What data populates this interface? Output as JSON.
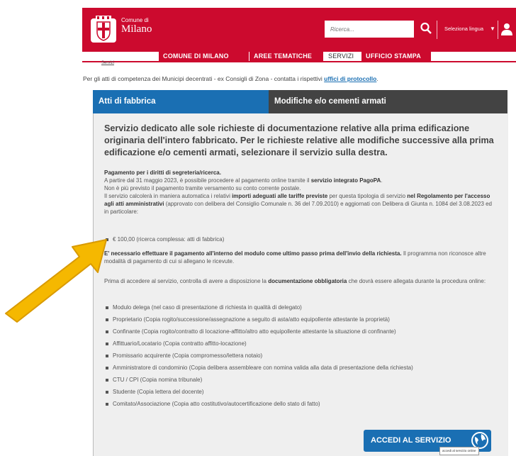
{
  "header": {
    "logo_small": "Comune di",
    "logo_big": "Milano",
    "search_placeholder": "Ricerca...",
    "language_label": "Seleziona lingua",
    "brand_color": "#cc0a2e"
  },
  "nav": {
    "items": [
      {
        "label": "COMUNE DI MILANO"
      },
      {
        "label": "AREE TEMATICHE"
      },
      {
        "label": "SERVIZI"
      },
      {
        "label": "UFFICIO STAMPA"
      }
    ],
    "active": "SERVIZI",
    "under_text": "Servizi"
  },
  "intro": {
    "text": "Per gli atti di competenza dei Municipi decentrati - ex Consigli di Zona - contatta i rispettivi ",
    "link": "uffici di protocollo",
    "end": "."
  },
  "tabs": [
    {
      "label": "Atti di fabbrica",
      "active": true
    },
    {
      "label": "Modifiche e/o cementi armati",
      "active": false
    }
  ],
  "content": {
    "headline": "Servizio dedicato alle sole richieste di documentazione relative alla prima edificazione originaria dell'intero fabbricato. Per le richieste relative alle modifiche successive alla prima edificazione e/o cementi armati, selezionare il servizio sulla destra.",
    "payment_title": "Pagamento per i diritti di segreteria/ricerca.",
    "payment_l1a": "A partire dal 31 maggio 2023, è possibile procedere al pagamento online tramite il ",
    "payment_l1b": "servizio integrato PagoPA",
    "payment_l1c": ".",
    "payment_l2": "Non è più previsto il pagamento tramite versamento su conto corrente postale.",
    "payment_l3a": "Il servizio calcolerà in maniera automatica i relativi ",
    "payment_l3b": "importi adeguati alle tariffe previste",
    "payment_l3c": " per questa tipologia di servizio ",
    "payment_l3d": "nel Regolamento per l'accesso agli atti amministrativi",
    "payment_l3e": " (approvato con delibera del Consiglio Comunale n. 36 del 7.09.2010) e aggiornati con Delibera di Giunta n. 1084 del 3.08.2023 ed in particolare:",
    "fee_item": "€ 100,00 (ricerca complessa: atti di fabbrica)",
    "notice_bold": "E' necessario effettuare il pagamento all'interno del modulo come ultimo passo prima dell'invio della richiesta.",
    "notice_rest": " Il programma non riconosce altre modalità di pagamento di cui si allegano le ricevute.",
    "docs_a": "Prima di accedere al servizio, controlla di avere a disposizione la ",
    "docs_b": "documentazione obbligatoria",
    "docs_c": " che dovrà essere allegata durante la procedura online:",
    "doc_list": [
      "Modulo delega (nel caso di presentazione di richiesta in qualità di delegato)",
      "Proprietario (Copia rogito/successione/assegnazione a seguito di asta/atto equipollente attestante la proprietà)",
      "Confinante (Copia rogito/contratto di locazione-affitto/altro atto equipollente attestante la situazione di confinante)",
      "Affittuario/Locatario (Copia contratto affitto-locazione)",
      "Promissario acquirente (Copia compromesso/lettera notaio)",
      "Amministratore di condominio (Copia delibera assembleare con nomina valida alla data di presentazione della richiesta)",
      "CTU / CPI (Copia nomina tribunale)",
      "Studente (Copia lettera del docente)",
      "Comitato/Associazione (Copia atto costitutivo/autocertificazione dello stato di fatto)"
    ]
  },
  "cta": {
    "label": "ACCEDI AL SERVIZIO",
    "tooltip": "accedi al servizio online",
    "color": "#1a6fb3"
  },
  "annotation": {
    "arrow_color": "#f5b800",
    "arrow_icon": "arrow-pointer-icon"
  }
}
